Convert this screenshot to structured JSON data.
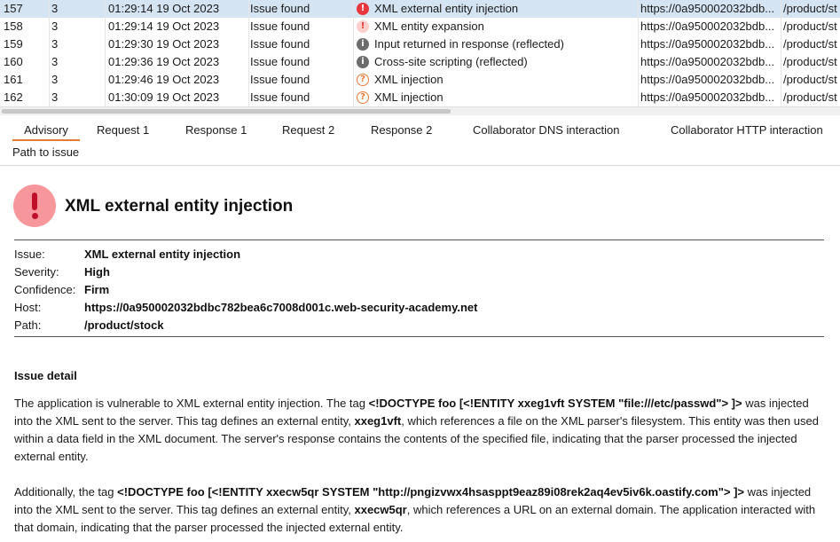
{
  "issues": [
    {
      "num": "157",
      "severity": "3",
      "time": "01:29:14 19 Oct 2023",
      "status": "Issue found",
      "icon": "high-severity-icon",
      "icon_glyph": "!",
      "icon_kind": "high",
      "name": "XML external entity injection",
      "host": "https://0a950002032bdb...",
      "path": "/product/st",
      "selected": true
    },
    {
      "num": "158",
      "severity": "3",
      "time": "01:29:14 19 Oct 2023",
      "status": "Issue found",
      "icon": "low-severity-icon",
      "icon_glyph": "!",
      "icon_kind": "low",
      "name": "XML entity expansion",
      "host": "https://0a950002032bdb...",
      "path": "/product/st",
      "selected": false
    },
    {
      "num": "159",
      "severity": "3",
      "time": "01:29:30 19 Oct 2023",
      "status": "Issue found",
      "icon": "info-icon",
      "icon_glyph": "i",
      "icon_kind": "info",
      "name": "Input returned in response (reflected)",
      "host": "https://0a950002032bdb...",
      "path": "/product/st",
      "selected": false
    },
    {
      "num": "160",
      "severity": "3",
      "time": "01:29:36 19 Oct 2023",
      "status": "Issue found",
      "icon": "info-icon",
      "icon_glyph": "i",
      "icon_kind": "info",
      "name": "Cross-site scripting (reflected)",
      "host": "https://0a950002032bdb...",
      "path": "/product/st",
      "selected": false
    },
    {
      "num": "161",
      "severity": "3",
      "time": "01:29:46 19 Oct 2023",
      "status": "Issue found",
      "icon": "tentative-icon",
      "icon_glyph": "?",
      "icon_kind": "tent",
      "name": "XML injection",
      "host": "https://0a950002032bdb...",
      "path": "/product/st",
      "selected": false
    },
    {
      "num": "162",
      "severity": "3",
      "time": "01:30:09 19 Oct 2023",
      "status": "Issue found",
      "icon": "tentative-icon",
      "icon_glyph": "?",
      "icon_kind": "tent",
      "name": "XML injection",
      "host": "https://0a950002032bdb...",
      "path": "/product/st",
      "selected": false
    }
  ],
  "tabs": {
    "advisory": "Advisory",
    "request1": "Request 1",
    "response1": "Response 1",
    "request2": "Request 2",
    "response2": "Response 2",
    "collab_dns": "Collaborator DNS interaction",
    "collab_http": "Collaborator HTTP interaction",
    "path_to_issue": "Path to issue"
  },
  "advisory": {
    "title": "XML external entity injection",
    "issue_label": "Issue:",
    "issue_value": "XML external entity injection",
    "severity_label": "Severity:",
    "severity_value": "High",
    "confidence_label": "Confidence:",
    "confidence_value": "Firm",
    "host_label": "Host:",
    "host_value": "https://0a950002032bdbc782bea6c7008d001c.web-security-academy.net",
    "path_label": "Path:",
    "path_value": "/product/stock",
    "detail_heading": "Issue detail",
    "p1": {
      "a": "The application is vulnerable to XML external entity injection. The tag ",
      "b": "<!DOCTYPE foo [<!ENTITY xxeg1vft SYSTEM \"file:///etc/passwd\"> ]>",
      "c": " was injected into the XML sent to the server. This tag defines an external entity, ",
      "d": "xxeg1vft",
      "e": ", which references a file on the XML parser's filesystem. This entity was then used within a data field in the XML document. The server's response contains the contents of the specified file, indicating that the parser processed the injected external entity."
    },
    "p2": {
      "a": "Additionally, the tag ",
      "b": "<!DOCTYPE foo [<!ENTITY xxecw5qr SYSTEM \"http://pngizvwx4hsasppt9eaz89i08rek2aq4ev5iv6k.oastify.com\"> ]>",
      "c": " was injected into the XML sent to the server. This tag defines an external entity, ",
      "d": "xxecw5qr",
      "e": ", which references a URL on an external domain. The application interacted with that domain, indicating that the parser processed the injected external entity."
    }
  }
}
